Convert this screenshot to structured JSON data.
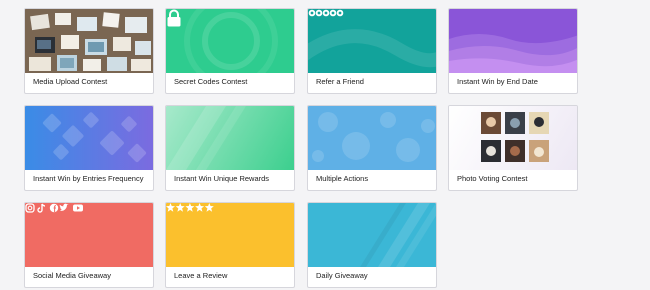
{
  "cards": [
    {
      "label": "Media Upload Contest"
    },
    {
      "label": "Secret Codes Contest"
    },
    {
      "label": "Refer a Friend"
    },
    {
      "label": "Instant Win by End Date"
    },
    {
      "label": "Instant Win by Entries Frequency"
    },
    {
      "label": "Instant Win Unique Rewards"
    },
    {
      "label": "Multiple Actions"
    },
    {
      "label": "Photo Voting Contest"
    },
    {
      "label": "Social Media Giveaway"
    },
    {
      "label": "Leave a Review"
    },
    {
      "label": "Daily Giveaway"
    }
  ],
  "colors": {
    "secret_codes": "#2ecc8f",
    "refer_friend": "#12a39b",
    "end_date": "#8a55d8",
    "entries_frequency": "#4f7fe6",
    "unique_rewards": "#58d59a",
    "multiple_actions": "#5fb0e6",
    "social_media": "#f06b63",
    "leave_review": "#fbc02d",
    "daily_giveaway": "#3bb7d6"
  },
  "icons": {
    "secret_codes": "lock-icon",
    "refer_friend": [
      "social-icon",
      "social-icon",
      "social-icon",
      "social-icon",
      "social-icon"
    ],
    "social_media": [
      "instagram-icon",
      "tiktok-icon",
      "facebook-icon",
      "twitter-icon",
      "youtube-icon"
    ],
    "leave_review": [
      "star-icon",
      "star-icon",
      "star-icon",
      "star-icon",
      "star-icon"
    ]
  }
}
